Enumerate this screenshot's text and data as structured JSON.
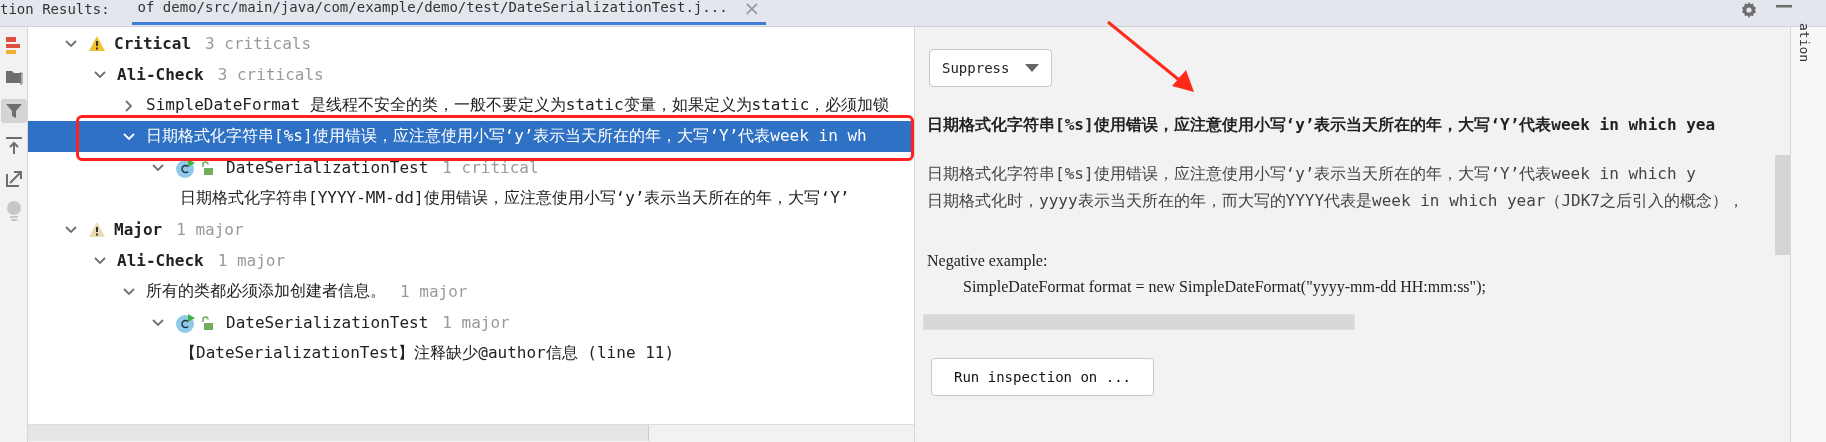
{
  "tab_bar": {
    "title": "tion Results:",
    "tab": {
      "label": "of  demo/src/main/java/com/example/demo/test/DateSerializationTest.j...",
      "close": "×"
    }
  },
  "tree": [
    {
      "kind": "severity",
      "color": "#f2c12e",
      "label": "Critical",
      "count": "3 criticals",
      "expanded": true,
      "selected": false,
      "children": [
        {
          "kind": "group",
          "label": "Ali-Check",
          "count": "3 criticals",
          "expanded": true,
          "selected": false,
          "children": [
            {
              "kind": "problem",
              "label": "SimpleDateFormat 是线程不安全的类，一般不要定义为static变量，如果定义为static，必须加锁",
              "expanded": false,
              "selected": false
            },
            {
              "kind": "problem",
              "label": "日期格式化字符串[%s]使用错误，应注意使用小写‘y’表示当天所在的年，大写‘Y’代表week in wh",
              "expanded": true,
              "selected": true,
              "children": [
                {
                  "kind": "file",
                  "label": "DateSerializationTest",
                  "count": "1 critical",
                  "expanded": true,
                  "selected": false,
                  "children": [
                    {
                      "kind": "detail",
                      "label": "日期格式化字符串[YYYY-MM-dd]使用错误，应注意使用小写‘y’表示当天所在的年，大写‘Y’",
                      "selected": false
                    }
                  ]
                }
              ]
            }
          ]
        }
      ]
    },
    {
      "kind": "severity",
      "color": "#e8dcb0",
      "label": "Major",
      "count": "1 major",
      "expanded": true,
      "selected": false,
      "children": [
        {
          "kind": "group",
          "label": "Ali-Check",
          "count": "1 major",
          "expanded": true,
          "selected": false,
          "children": [
            {
              "kind": "problem",
              "label": "所有的类都必须添加创建者信息。",
              "count": "1 major",
              "expanded": true,
              "selected": false,
              "children": [
                {
                  "kind": "file",
                  "label": "DateSerializationTest",
                  "count": "1 major",
                  "expanded": true,
                  "selected": false,
                  "children": [
                    {
                      "kind": "detail",
                      "label": "【DateSerializationTest】注释缺少@author信息 (line 11)",
                      "selected": false
                    }
                  ]
                }
              ]
            }
          ]
        }
      ]
    }
  ],
  "detail": {
    "suppress_button": "Suppress",
    "title": "日期格式化字符串[%s]使用错误，应注意使用小写‘y’表示当天所在的年，大写‘Y’代表week in which yea",
    "description": [
      "日期格式化字符串[%s]使用错误，应注意使用小写‘y’表示当天所在的年，大写‘Y’代表week in which y",
      "日期格式化时，yyyy表示当天所在的年，而大写的YYYY代表是week in which year（JDK7之后引入的概念），"
    ],
    "example_label": "Negative example:",
    "example_code": "SimpleDateFormat format = new SimpleDateFormat(\"yyyy-mm-dd HH:mm:ss\");",
    "run_button": "Run inspection on ..."
  },
  "side_label": "ation"
}
